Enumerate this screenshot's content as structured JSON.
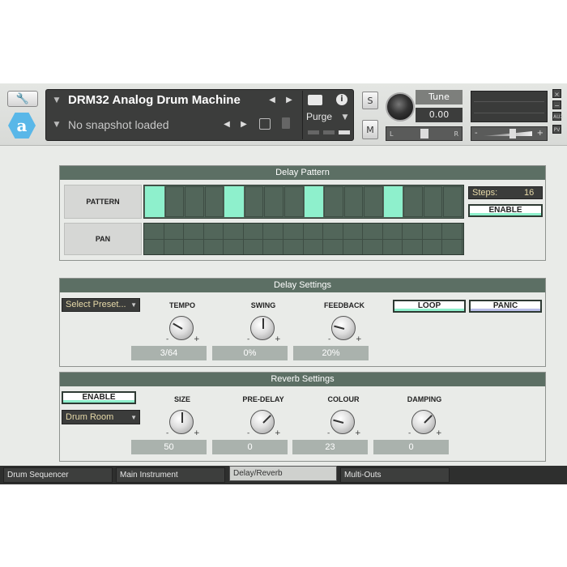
{
  "header": {
    "instrument_title": "DRM32 Analog Drum Machine",
    "snapshot_text": "No snapshot loaded",
    "purge_label": "Purge",
    "solo_label": "S",
    "mute_label": "M",
    "tune_label": "Tune",
    "tune_value": "0.00",
    "pan_left": "L",
    "pan_right": "R",
    "vol_minus": "-",
    "vol_plus": "+",
    "aux_label": "AUX",
    "pv_label": "PV",
    "close_label": "×",
    "min_label": "−"
  },
  "delay_pattern": {
    "title": "Delay Pattern",
    "pattern_label": "PATTERN",
    "pan_label": "PAN",
    "steps_label": "Steps:",
    "steps_value": "16",
    "enable_label": "ENABLE",
    "active_steps": [
      1,
      5,
      9,
      13
    ]
  },
  "delay_settings": {
    "title": "Delay Settings",
    "preset_label": "Select Preset...",
    "loop_label": "LOOP",
    "panic_label": "PANIC",
    "knobs": [
      {
        "label": "TEMPO",
        "value": "3/64"
      },
      {
        "label": "SWING",
        "value": "0%"
      },
      {
        "label": "FEEDBACK",
        "value": "20%"
      }
    ]
  },
  "reverb_settings": {
    "title": "Reverb Settings",
    "enable_label": "ENABLE",
    "room_label": "Drum Room",
    "knobs": [
      {
        "label": "SIZE",
        "value": "50"
      },
      {
        "label": "PRE-DELAY",
        "value": "0"
      },
      {
        "label": "COLOUR",
        "value": "23"
      },
      {
        "label": "DAMPING",
        "value": "0"
      }
    ]
  },
  "tabs": [
    {
      "label": "Drum Sequencer"
    },
    {
      "label": "Main Instrument"
    },
    {
      "label": "Delay/Reverb"
    },
    {
      "label": "Multi-Outs"
    }
  ],
  "colors": {
    "accent": "#8ef0cc",
    "section_bar": "#5c6f64",
    "grid": "#52665a",
    "logo": "#59b7e8"
  }
}
